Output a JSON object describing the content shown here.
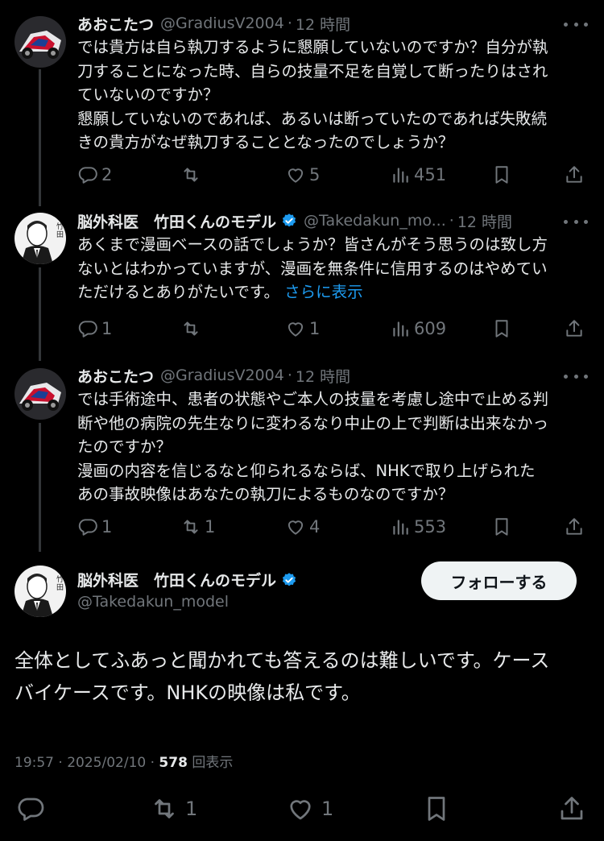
{
  "tweets": [
    {
      "name": "あおこたつ",
      "handle": "@GradiusV2004",
      "time": "12 時間",
      "body": "では貴方は自ら執刀するように懇願していないのですか？自分が執\n刀することになった時、自らの技量不足を自覚して断ったりはされ\nていないのですか？\n懇願していないのであれば、あるいは断っていたのであれば失敗続\nきの貴方がなぜ執刀することとなったのでしょうか？",
      "replies": "2",
      "retweets": "",
      "likes": "5",
      "views": "451"
    },
    {
      "name": "脳外科医　竹田くんのモデル",
      "handle": "@Takedakun_mo...",
      "time": "12 時間",
      "body": "あくまで漫画ベースの話でしょうか？皆さんがそう思うのは致し方\nないとはわかっていますが、漫画を無条件に信用するのはやめてい\nただけるとありがたいです。",
      "show_more": "さらに表示",
      "replies": "1",
      "retweets": "",
      "likes": "1",
      "views": "609"
    },
    {
      "name": "あおこたつ",
      "handle": "@GradiusV2004",
      "time": "12 時間",
      "body": "では手術途中、患者の状態やご本人の技量を考慮し途中で止める判\n断や他の病院の先生なりに変わるなり中止の上で判断は出来なかっ\nたのですか？\n漫画の内容を信じるなと仰られるならば、NHKで取り上げられた\nあの事故映像はあなたの執刀によるものなのですか？",
      "replies": "1",
      "retweets": "1",
      "likes": "4",
      "views": "553"
    }
  ],
  "main": {
    "name": "脳外科医　竹田くんのモデル",
    "handle": "@Takedakun_model",
    "follow_label": "フォローする",
    "text": "全体としてふあっと聞かれても答えるのは難しいです。ケース\nバイケースです。NHKの映像は私です。",
    "time": "19:57",
    "date": "2025/02/10",
    "views_count": "578",
    "views_label": "回表示",
    "retweets": "1",
    "likes": "1"
  },
  "separator": "·",
  "icons": [
    "reply-icon",
    "retweet-icon",
    "like-icon",
    "views-icon",
    "bookmark-icon",
    "share-icon",
    "more-icon",
    "verified-icon"
  ],
  "colors": {
    "background": "#000000",
    "text": "#e7e9ea",
    "muted": "#71767b",
    "link": "#1d9bf0",
    "verified": "#1d9bf0"
  }
}
